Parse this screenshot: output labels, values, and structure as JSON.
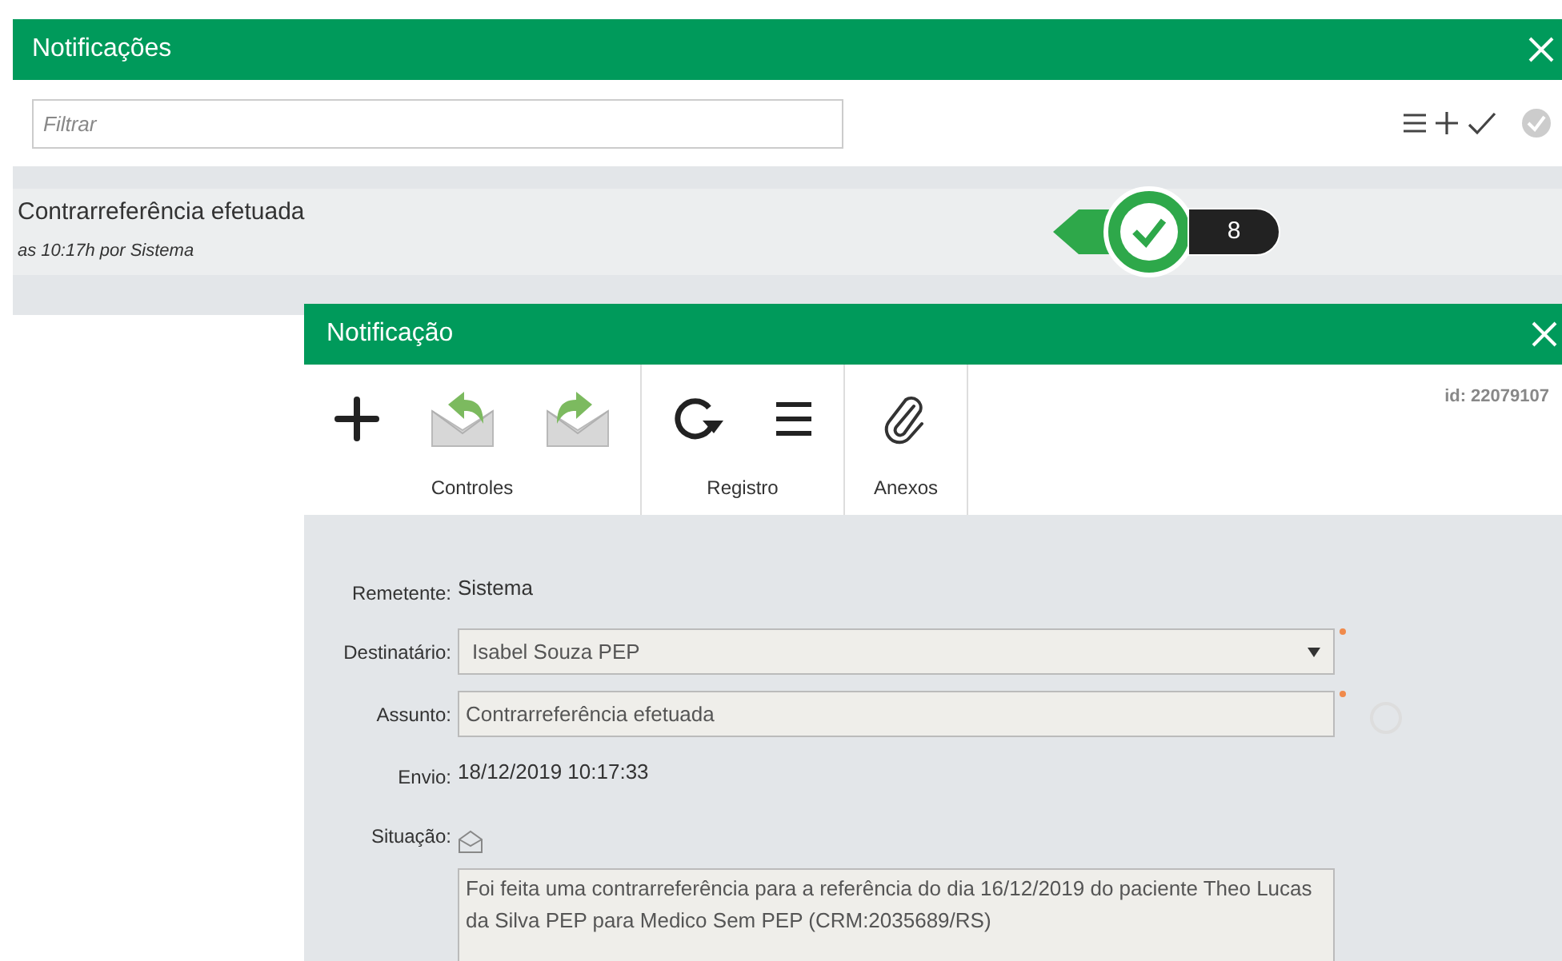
{
  "panel": {
    "title": "Notificações",
    "filter": {
      "placeholder": "Filtrar"
    }
  },
  "notifications": [
    {
      "title": "Contrarreferência efetuada",
      "meta": "as 10:17h por Sistema",
      "count": "8"
    }
  ],
  "dialog": {
    "title": "Notificação",
    "id": "id: 22079107",
    "groups": [
      {
        "label": "Controles",
        "tools": [
          {
            "kind": "plus"
          },
          {
            "kind": "reply"
          },
          {
            "kind": "forward"
          }
        ]
      },
      {
        "label": "Registro",
        "tools": [
          {
            "kind": "refresh"
          },
          {
            "kind": "list"
          }
        ]
      },
      {
        "label": "Anexos",
        "tools": [
          {
            "kind": "clip"
          }
        ]
      }
    ],
    "fields": [
      {
        "kind": "text",
        "label": "Remetente:",
        "value": "Sistema"
      },
      {
        "kind": "select",
        "label": "Destinatário:",
        "value": "Isabel Souza PEP",
        "required": true
      },
      {
        "kind": "input",
        "label": "Assunto:",
        "value": "Contrarreferência efetuada",
        "required": true
      },
      {
        "kind": "text",
        "label": "Envio:",
        "value": "18/12/2019 10:17:33"
      },
      {
        "kind": "status",
        "label": "Situação:"
      },
      {
        "kind": "textarea",
        "value": "Foi feita uma contrarreferência para a referência do dia 16/12/2019 do paciente Theo Lucas da Silva PEP para Medico Sem PEP (CRM:2035689/RS)"
      }
    ]
  }
}
